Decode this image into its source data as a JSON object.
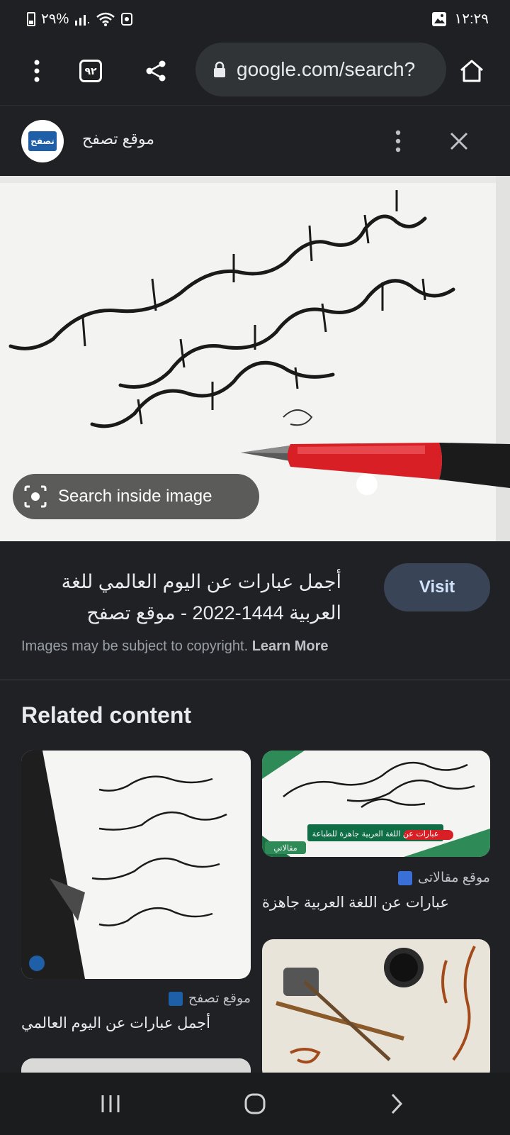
{
  "status_bar": {
    "time": "١٢:٢٩",
    "battery_percent": "٢٩%"
  },
  "toolbar": {
    "tab_count": "٩٢",
    "url": "google.com/search?"
  },
  "site_header": {
    "logo_text": "تصفح",
    "site_name": "موقع تصفح"
  },
  "image_viewer": {
    "lens_chip_label": "Search inside image"
  },
  "result": {
    "title": "أجمل عبارات عن اليوم العالمي للغة العربية 1444-2022 - موقع تصفح",
    "visit_label": "Visit",
    "copyright_text": "Images may be subject to copyright. ",
    "learn_more": "Learn More"
  },
  "related": {
    "heading": "Related content",
    "cards": [
      {
        "source": "موقع مقالاتى",
        "title": "عبارات عن اللغة العربية جاهزة",
        "banner": "عبارات عن اللغة العربية جاهزة للطباعة",
        "badge": "مقالاتي"
      },
      {
        "source": "موقع تصفح",
        "title": "أجمل عبارات عن اليوم العالمي"
      },
      {
        "source": "",
        "title": ""
      }
    ]
  },
  "colors": {
    "background": "#202124",
    "visit_button": "#394457",
    "pen_red": "#d91f26"
  }
}
